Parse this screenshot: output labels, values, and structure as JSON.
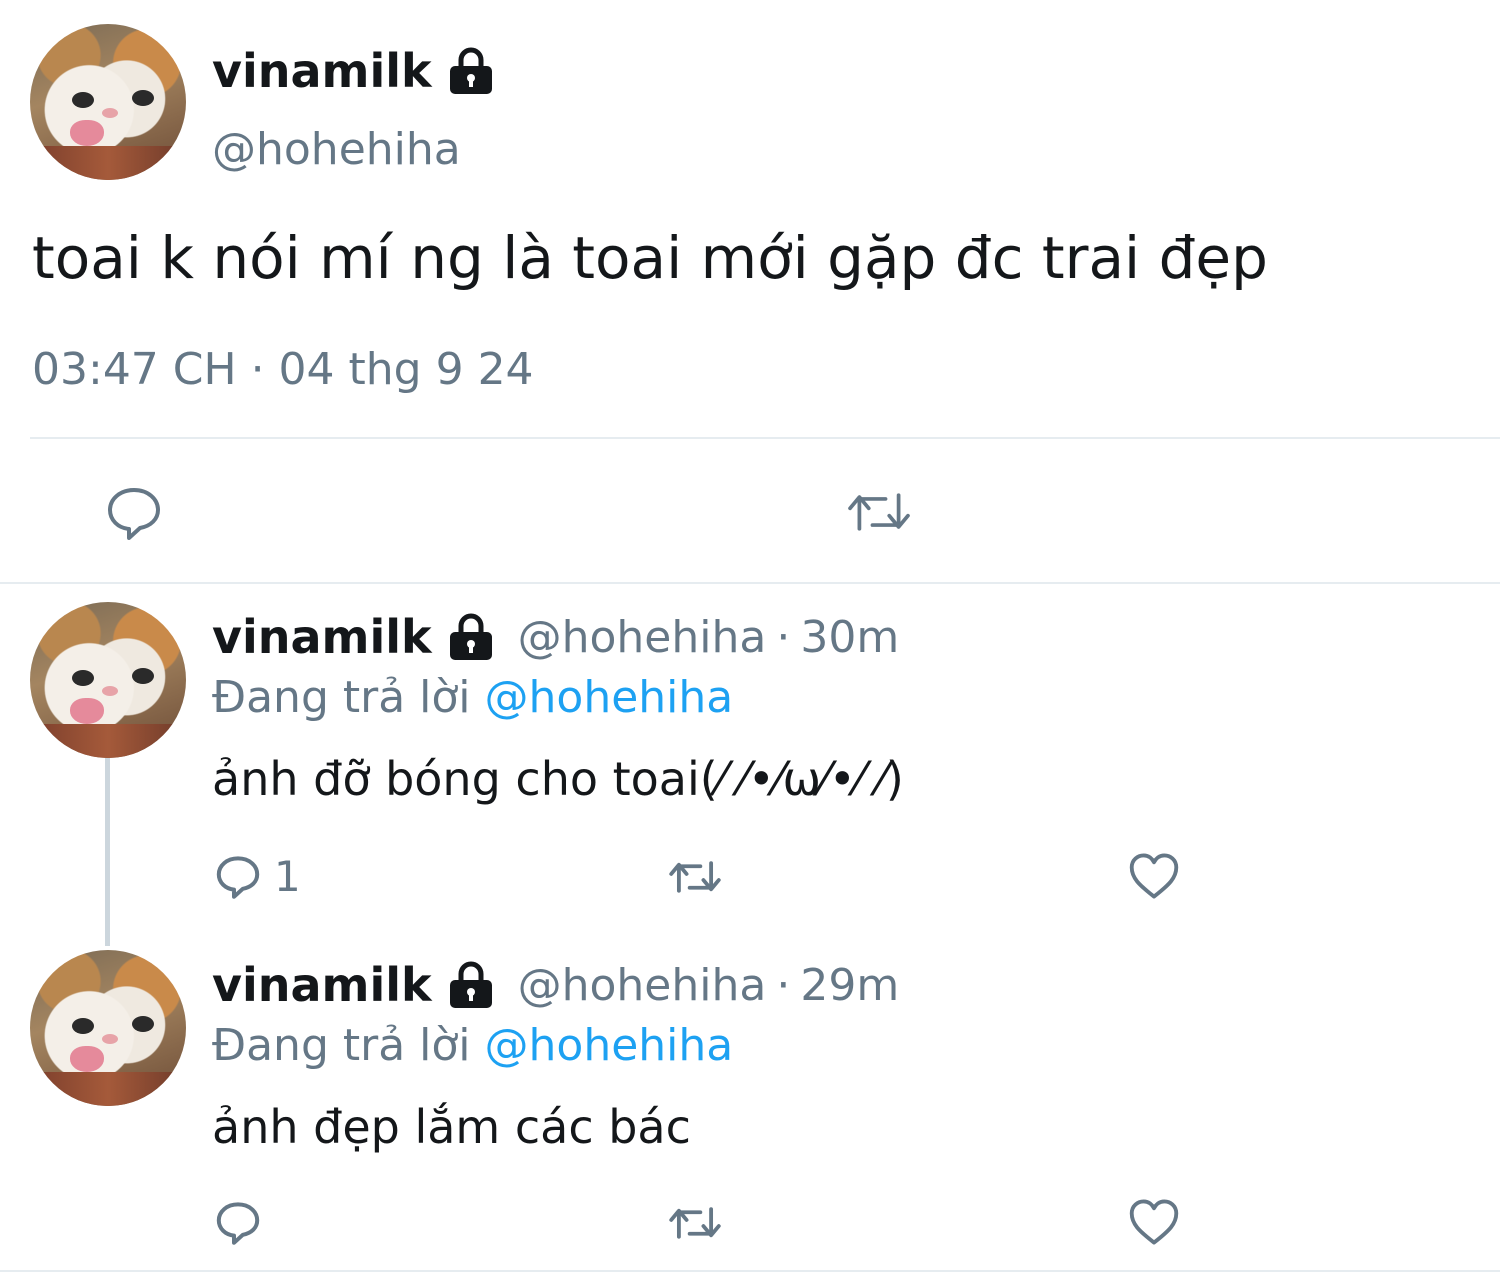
{
  "main_tweet": {
    "display_name": "vinamilk",
    "handle": "@hohehiha",
    "text": "toai k nói mí ng là toai mới gặp đc trai đẹp",
    "timestamp": "03:47 CH · 04 thg 9 24",
    "actions": [
      "reply-icon",
      "retweet-icon"
    ]
  },
  "replies": [
    {
      "display_name": "vinamilk",
      "handle": "@hohehiha",
      "time": "30m",
      "replying_label": "Đang trả lời",
      "replying_to": "@hohehiha",
      "text": "ảnh đỡ bóng cho toai(⁄ ⁄•⁄ω⁄•⁄ ⁄)",
      "reply_count": "1"
    },
    {
      "display_name": "vinamilk",
      "handle": "@hohehiha",
      "time": "29m",
      "replying_label": "Đang trả lời",
      "replying_to": "@hohehiha",
      "text": "ảnh đẹp lắm các bác",
      "reply_count": ""
    }
  ],
  "colors": {
    "text": "#14171a",
    "secondary": "#657786",
    "link": "#1da1f2",
    "divider": "#e6ecf0"
  }
}
